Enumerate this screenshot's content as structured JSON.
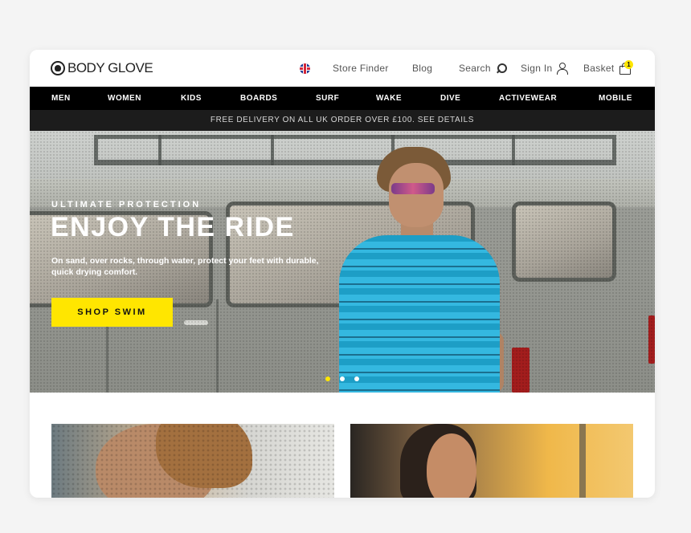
{
  "brand": {
    "logo_text": "BODY GLOVE"
  },
  "header": {
    "store_finder": "Store Finder",
    "blog": "Blog",
    "search": "Search",
    "sign_in": "Sign In",
    "basket": "Basket",
    "basket_count": "1"
  },
  "nav": {
    "items": [
      "MEN",
      "WOMEN",
      "KIDS",
      "BOARDS",
      "SURF",
      "WAKE",
      "DIVE",
      "ACTIVEWEAR",
      "MOBILE"
    ]
  },
  "promo": {
    "text": "FREE DELIVERY ON ALL UK ORDER OVER £100. SEE DETAILS"
  },
  "hero": {
    "eyebrow": "ULTIMATE PROTECTION",
    "title": "ENJOY THE RIDE",
    "subtitle": "On sand, over rocks, through water, protect your feet with durable, quick drying comfort.",
    "cta": "SHOP SWIM",
    "slides": 3,
    "active_slide": 1
  },
  "colors": {
    "accent": "#ffe600",
    "nav_bg": "#000000",
    "promo_bg": "#1c1c1c"
  },
  "icons": [
    "uk-flag-icon",
    "search-icon",
    "user-icon",
    "basket-icon"
  ]
}
